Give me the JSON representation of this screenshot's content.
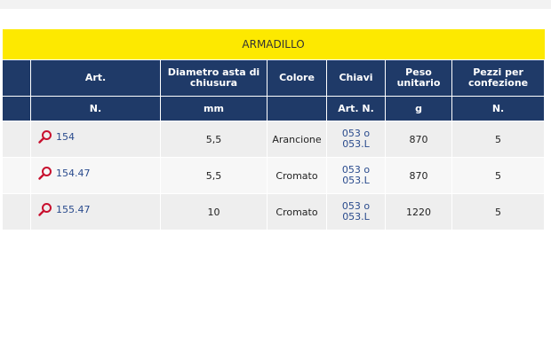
{
  "table": {
    "title": "ARMADILLO",
    "header_row1": [
      "",
      "Art.",
      "Diametro asta di chiusura",
      "Colore",
      "Chiavi",
      "Peso unitario",
      "Pezzi per confezione"
    ],
    "header_row2": [
      "",
      "N.",
      "mm",
      "",
      "Art. N.",
      "g",
      "N."
    ],
    "rows": [
      {
        "art": "154",
        "diametro": "5,5",
        "colore": "Arancione",
        "chiavi_1": "053 o",
        "chiavi_2": "053.L",
        "peso": "870",
        "pezzi": "5"
      },
      {
        "art": "154.47",
        "diametro": "5,5",
        "colore": "Cromato",
        "chiavi_1": "053 o",
        "chiavi_2": "053.L",
        "peso": "870",
        "pezzi": "5"
      },
      {
        "art": "155.47",
        "diametro": "10",
        "colore": "Cromato",
        "chiavi_1": "053 o",
        "chiavi_2": "053.L",
        "peso": "1220",
        "pezzi": "5"
      }
    ]
  },
  "icons": {
    "row_icon": "magnifier-icon"
  },
  "colors": {
    "title_bg": "#fde900",
    "header_bg": "#1f3a68",
    "link": "#2a4b8d",
    "icon": "#c8102e"
  }
}
